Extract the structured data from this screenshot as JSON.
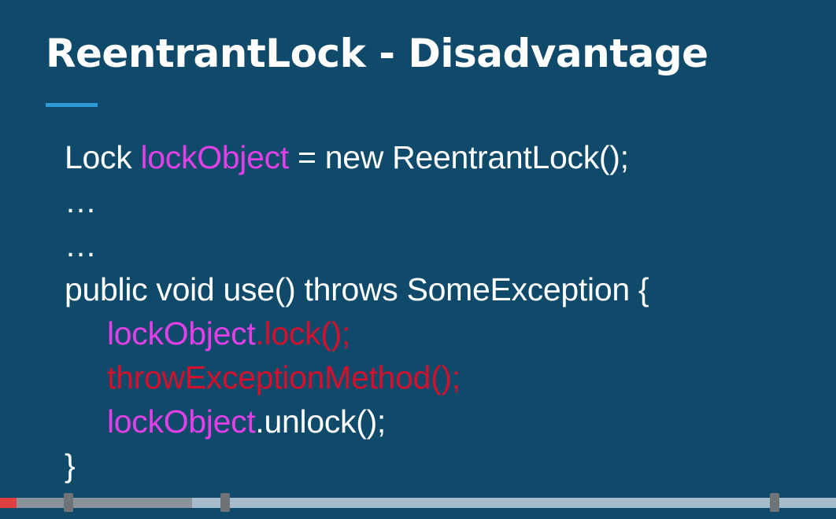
{
  "slide": {
    "title": "ReentrantLock - Disadvantage"
  },
  "code": {
    "line1": {
      "prefix": "Lock ",
      "var": "lockObject",
      "suffix": "  = new ReentrantLock();"
    },
    "line2": "…",
    "line3": "…",
    "line4": "public void use() throws SomeException {",
    "line5": {
      "var": "lockObject",
      "call": ".lock();"
    },
    "line6": "throwExceptionMethod();",
    "line7": {
      "var": "lockObject",
      "call": ".unlock();"
    },
    "line8": "}"
  },
  "colors": {
    "background": "#0f4a6b",
    "title_underline": "#2f9bd6",
    "variable": "#e23fe6",
    "highlight_red": "#d4102c",
    "progress_played": "#e0403f"
  },
  "video_progress": {
    "played_fraction": 0.02,
    "buffered_fraction": 0.23
  }
}
